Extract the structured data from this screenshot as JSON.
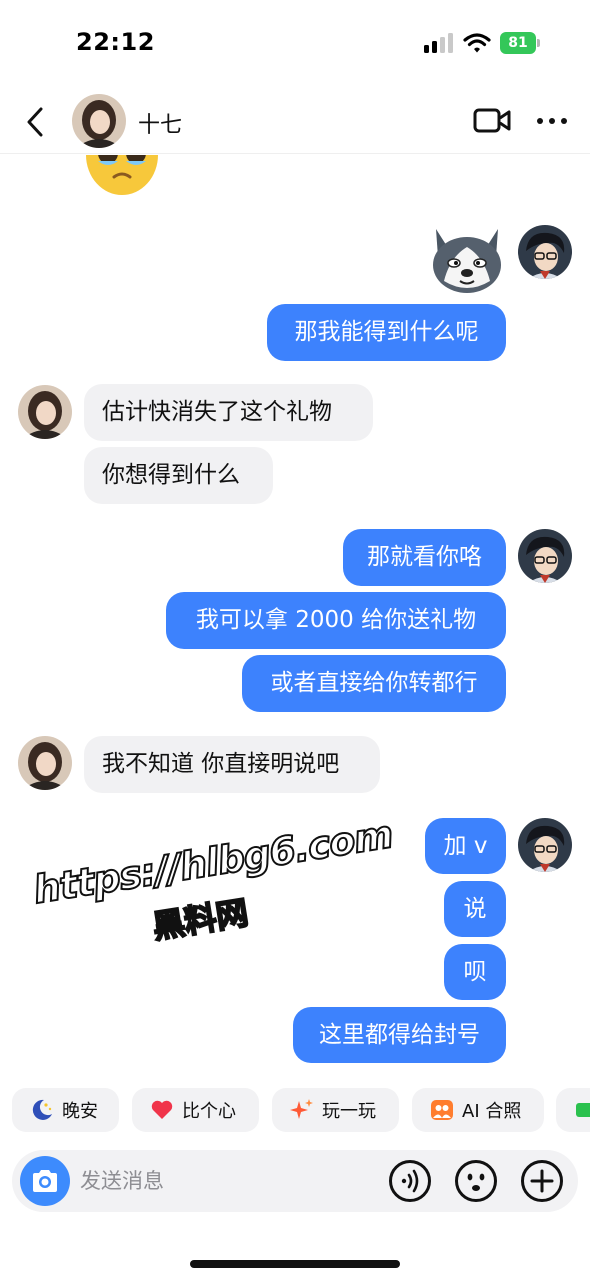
{
  "status_bar": {
    "time": "22:12",
    "battery": "81"
  },
  "header": {
    "contact_name": "十七",
    "back_icon": "chevron-left-icon",
    "video_icon": "video-camera-icon",
    "more_icon": "more-dots-icon"
  },
  "messages": [
    {
      "side": "in",
      "type": "emoji",
      "icon": "crying-face-emoji"
    },
    {
      "side": "out",
      "type": "sticker",
      "icon": "husky-dog-sticker"
    },
    {
      "side": "out",
      "type": "text",
      "text": "那我能得到什么呢"
    },
    {
      "side": "in",
      "type": "text",
      "text": "估计快消失了这个礼物"
    },
    {
      "side": "in",
      "type": "text",
      "text": "你想得到什么"
    },
    {
      "side": "out",
      "type": "text",
      "text": "那就看你咯"
    },
    {
      "side": "out",
      "type": "text",
      "text": "我可以拿 2000 给你送礼物"
    },
    {
      "side": "out",
      "type": "text",
      "text": "或者直接给你转都行"
    },
    {
      "side": "in",
      "type": "text",
      "text": "我不知道 你直接明说吧"
    },
    {
      "side": "out",
      "type": "text",
      "text": "加 v"
    },
    {
      "side": "out",
      "type": "text",
      "text": "说"
    },
    {
      "side": "out",
      "type": "text",
      "text": "呗"
    },
    {
      "side": "out",
      "type": "text",
      "text": "这里都得给封号"
    }
  ],
  "watermark": {
    "url": "https://hlbg6.com",
    "label": "黑料网"
  },
  "quick_replies": [
    {
      "label": "晚安",
      "icon": "moon-icon"
    },
    {
      "label": "比个心",
      "icon": "heart-icon"
    },
    {
      "label": "玩一玩",
      "icon": "sparkle-icon"
    },
    {
      "label": "AI 合照",
      "icon": "photo-people-icon"
    }
  ],
  "composer": {
    "placeholder": "发送消息",
    "camera_icon": "camera-icon",
    "voice_icon": "voice-icon",
    "emoji_icon": "emoji-icon",
    "plus_icon": "plus-icon"
  },
  "colors": {
    "outgoing_bubble": "#3d82fd",
    "incoming_bubble": "#f1f1f3",
    "camera_button": "#3d8bfd",
    "battery": "#34c759"
  }
}
